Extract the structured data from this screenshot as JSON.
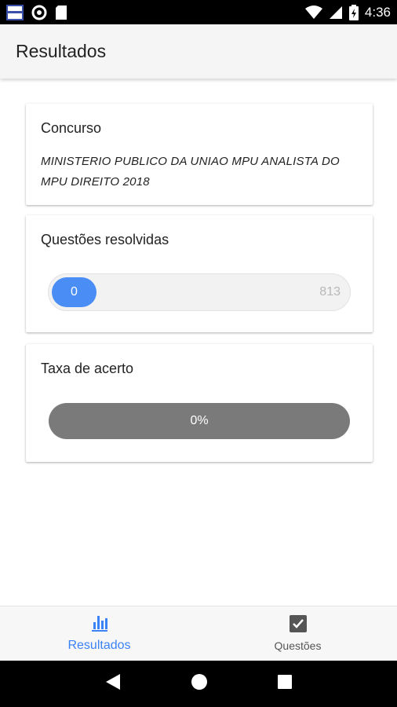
{
  "status_bar": {
    "time": "4:36",
    "left_icons": [
      "news-app-icon",
      "circle-notification-icon",
      "sd-card-icon"
    ],
    "right_icons": [
      "wifi-icon",
      "signal-icon",
      "battery-icon"
    ]
  },
  "app_bar": {
    "title": "Resultados"
  },
  "cards": {
    "concurso": {
      "label": "Concurso",
      "value": "MINISTERIO PUBLICO DA UNIAO MPU ANALISTA DO MPU DIREITO 2018"
    },
    "questoes_resolvidas": {
      "label": "Questões resolvidas",
      "current": "0",
      "total": "813",
      "progress_fraction": 0,
      "fill_color": "#4a8ef5"
    },
    "taxa_acerto": {
      "label": "Taxa de acerto",
      "value": "0%",
      "bar_color": "#7a7a7a"
    }
  },
  "bottom_nav": {
    "items": [
      {
        "label": "Resultados",
        "icon": "bar-chart-icon",
        "active": true
      },
      {
        "label": "Questões",
        "icon": "checkbox-icon",
        "active": false
      }
    ],
    "accent_color": "#3b82f6"
  },
  "system_nav": {
    "icons": [
      "back-icon",
      "home-icon",
      "recents-icon"
    ]
  }
}
